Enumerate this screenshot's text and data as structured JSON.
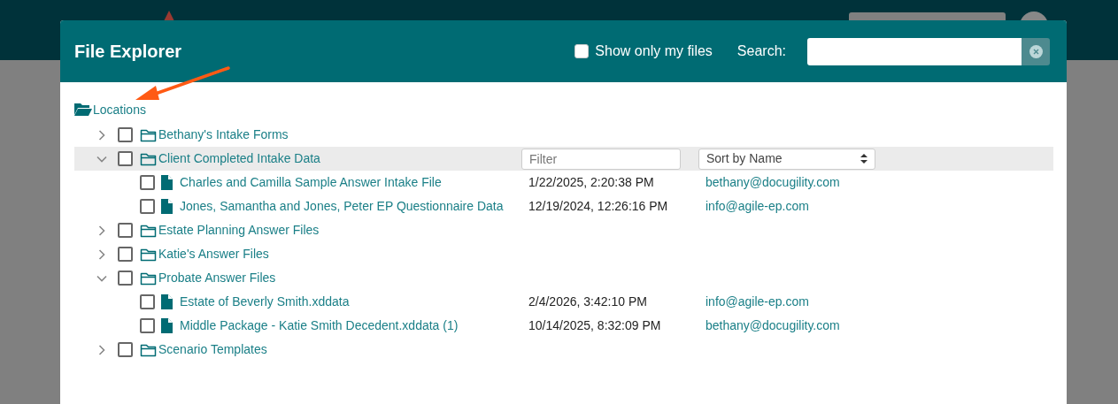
{
  "dialog": {
    "title": "File Explorer",
    "show_only_my_files": {
      "label": "Show only my files",
      "checked": false
    },
    "search": {
      "label": "Search:"
    },
    "tree": {
      "label": "Locations",
      "children": [
        {
          "label": "Bethany's Intake Forms",
          "expanded": false,
          "checked": false,
          "selected": false
        },
        {
          "label": "Client Completed Intake Data",
          "expanded": true,
          "checked": false,
          "selected": true,
          "filter": {
            "placeholder": "Filter"
          },
          "sort": {
            "value": "Sort by Name"
          },
          "children": [
            {
              "name": "Charles and Camilla Sample Answer Intake File",
              "modified": "1/22/2025, 2:20:38 PM",
              "owner": "bethany@docugility.com",
              "checked": false
            },
            {
              "name": "Jones, Samantha and Jones, Peter EP Questionnaire Data",
              "modified": "12/19/2024, 12:26:16 PM",
              "owner": "info@agile-ep.com",
              "checked": false
            }
          ]
        },
        {
          "label": "Estate Planning Answer Files",
          "expanded": false,
          "checked": false,
          "selected": false
        },
        {
          "label": "Katie's Answer Files",
          "expanded": false,
          "checked": false,
          "selected": false
        },
        {
          "label": "Probate Answer Files",
          "expanded": true,
          "checked": false,
          "selected": false,
          "children": [
            {
              "name": "Estate of Beverly Smith.xddata",
              "modified": "2/4/2026, 3:42:10 PM",
              "owner": "info@agile-ep.com",
              "checked": false
            },
            {
              "name": "Middle Package - Katie Smith Decedent.xddata (1)",
              "modified": "10/14/2025, 8:32:09 PM",
              "owner": "bethany@docugility.com",
              "checked": false
            }
          ]
        },
        {
          "label": "Scenario Templates",
          "expanded": false,
          "checked": false,
          "selected": false
        }
      ]
    }
  }
}
